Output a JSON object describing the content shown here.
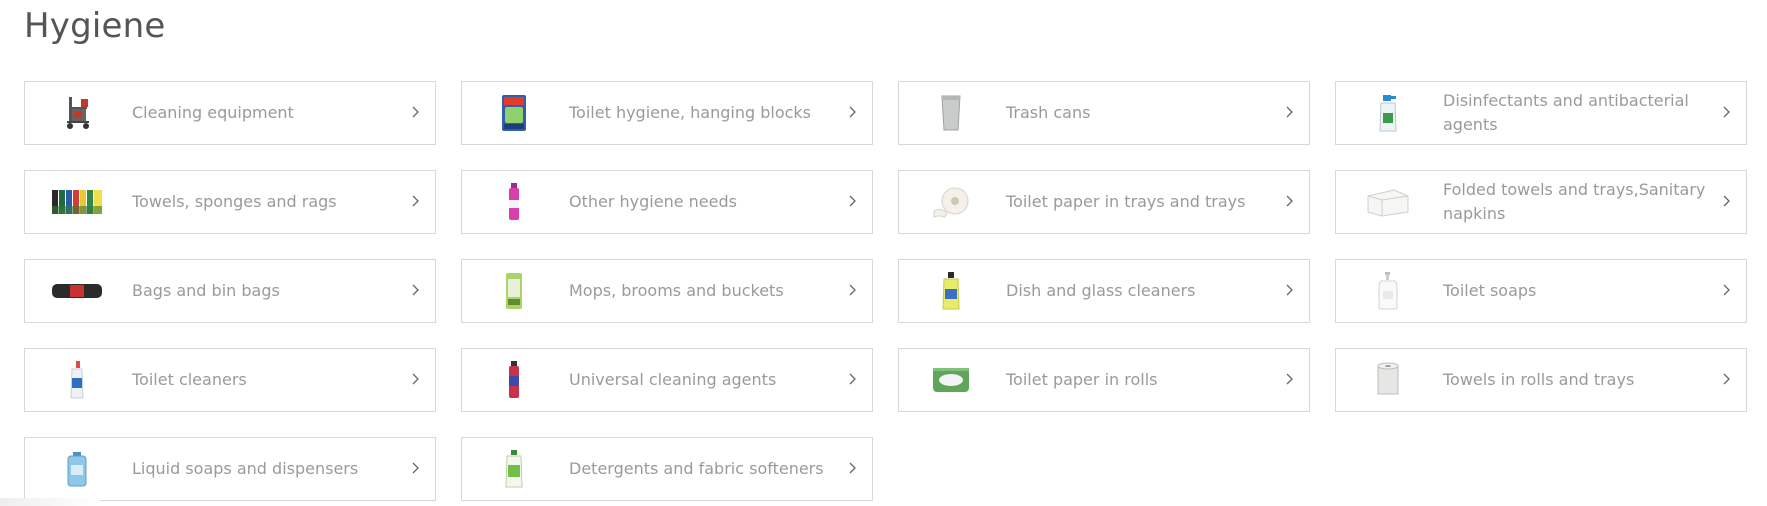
{
  "page": {
    "title": "Hygiene"
  },
  "categories": [
    {
      "label": "Cleaning equipment",
      "icon": "cleaning-cart-icon"
    },
    {
      "label": "Toilet hygiene, hanging blocks",
      "icon": "toilet-block-pack-icon"
    },
    {
      "label": "Trash cans",
      "icon": "trash-can-icon"
    },
    {
      "label": "Disinfectants and antibacterial agents",
      "icon": "disinfectant-spray-icon"
    },
    {
      "label": "Towels, sponges and rags",
      "icon": "sponges-icon"
    },
    {
      "label": "Other hygiene needs",
      "icon": "aerosol-can-icon"
    },
    {
      "label": "Toilet paper in trays and trays",
      "icon": "jumbo-toilet-roll-icon"
    },
    {
      "label": "Folded towels and trays,Sanitary napkins",
      "icon": "folded-towels-icon"
    },
    {
      "label": "Bags and bin bags",
      "icon": "bin-bags-roll-icon"
    },
    {
      "label": "Mops, brooms and buckets",
      "icon": "mop-pack-icon"
    },
    {
      "label": "Dish and glass cleaners",
      "icon": "dish-cleaner-bottle-icon"
    },
    {
      "label": "Toilet soaps",
      "icon": "soap-pump-icon"
    },
    {
      "label": "Toilet cleaners",
      "icon": "toilet-cleaner-bottle-icon"
    },
    {
      "label": "Universal cleaning agents",
      "icon": "cleaning-spray-can-icon"
    },
    {
      "label": "Toilet paper in rolls",
      "icon": "toilet-paper-pack-icon"
    },
    {
      "label": "Towels in rolls and trays",
      "icon": "paper-towel-roll-icon"
    },
    {
      "label": "Liquid soaps and dispensers",
      "icon": "liquid-soap-canister-icon"
    },
    {
      "label": "Detergents and fabric softeners",
      "icon": "detergent-bottle-icon"
    }
  ]
}
